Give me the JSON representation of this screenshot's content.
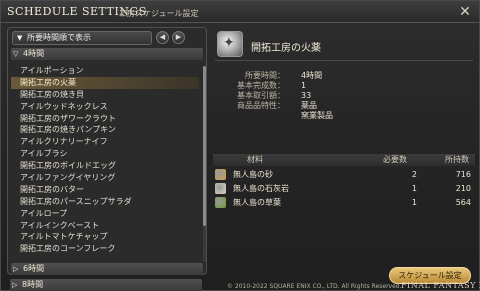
{
  "window": {
    "title": "SCHEDULE SETTINGS",
    "subtitle": "工房スケジュール設定"
  },
  "left": {
    "sort_label": "所要時間順で表示",
    "groups": [
      {
        "label": "4時間",
        "expanded": true
      },
      {
        "label": "6時間",
        "expanded": false
      },
      {
        "label": "8時間",
        "expanded": false
      }
    ],
    "recipes": [
      "アイルポーション",
      "開拓工房の火薬",
      "開拓工房の焼き貝",
      "アイルウッドネックレス",
      "開拓工房のザワークラウト",
      "開拓工房の焼きパンプキン",
      "アイルクリナリーナイフ",
      "アイルブラシ",
      "開拓工房のボイルドエッグ",
      "アイルファングイヤリング",
      "開拓工房のバター",
      "開拓工房のパースニップサラダ",
      "アイルロープ",
      "アイルインクベースト",
      "アイルトマトケチャップ",
      "開拓工房のコーンフレーク"
    ],
    "selected_index": 1
  },
  "detail": {
    "item_name": "開拓工房の火薬",
    "info": [
      {
        "label": "所要時間：",
        "value": "4時間"
      },
      {
        "label": "基本完成数：",
        "value": "1"
      },
      {
        "label": "基本取引額：",
        "value": "33"
      },
      {
        "label": "商品品特性：",
        "value": "薬品"
      },
      {
        "label": "",
        "value": "窯業製品"
      }
    ]
  },
  "materials": {
    "headers": {
      "name": "材料",
      "required": "必要数",
      "owned": "所持数"
    },
    "rows": [
      {
        "name": "無人島の砂",
        "required": "2",
        "owned": "716",
        "icon": "sand-icon",
        "color": "#c9a24a"
      },
      {
        "name": "無人島の石灰岩",
        "required": "1",
        "owned": "210",
        "icon": "limestone-icon",
        "color": "#d9d4c6"
      },
      {
        "name": "無人島の草葉",
        "required": "1",
        "owned": "564",
        "icon": "leaf-icon",
        "color": "#6f9b3a"
      }
    ]
  },
  "footer": {
    "schedule_button": "スケジュール設定",
    "copyright": "© 2010-2022 SQUARE ENIX CO., LTD. All Rights Reserved.",
    "logo": "FINAL FANTASY XIV"
  },
  "colors": {
    "accent": "#e3c27a",
    "selected_row": "#6a5a3a"
  }
}
